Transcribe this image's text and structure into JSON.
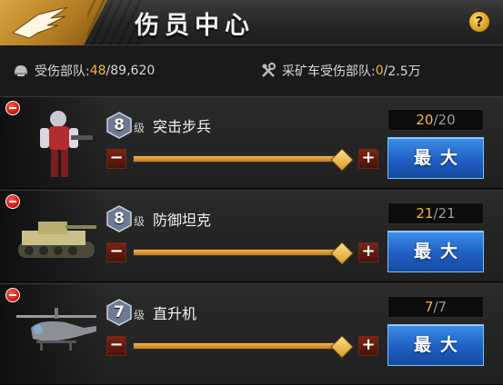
{
  "header": {
    "title": "伤员中心",
    "help_symbol": "?"
  },
  "summary": {
    "wounded": {
      "label": "受伤部队:",
      "current": "48",
      "separator": "/",
      "max": "89,620"
    },
    "miner": {
      "label": "采矿车受伤部队:",
      "current": "0",
      "separator": "/",
      "max": "2.5万"
    }
  },
  "units": [
    {
      "level": "8",
      "level_tag": "级",
      "name": "突击步兵",
      "count_current": "20",
      "count_max": "20",
      "slider_fraction": 1.0,
      "max_label": "最大",
      "minus": "−",
      "plus": "+"
    },
    {
      "level": "8",
      "level_tag": "级",
      "name": "防御坦克",
      "count_current": "21",
      "count_max": "21",
      "slider_fraction": 1.0,
      "max_label": "最大",
      "minus": "−",
      "plus": "+"
    },
    {
      "level": "7",
      "level_tag": "级",
      "name": "直升机",
      "count_current": "7",
      "count_max": "7",
      "slider_fraction": 1.0,
      "max_label": "最大",
      "minus": "−",
      "plus": "+"
    }
  ],
  "colors": {
    "accent": "#f0b93c",
    "button": "#1f5fc4",
    "remove": "#c4150a"
  }
}
